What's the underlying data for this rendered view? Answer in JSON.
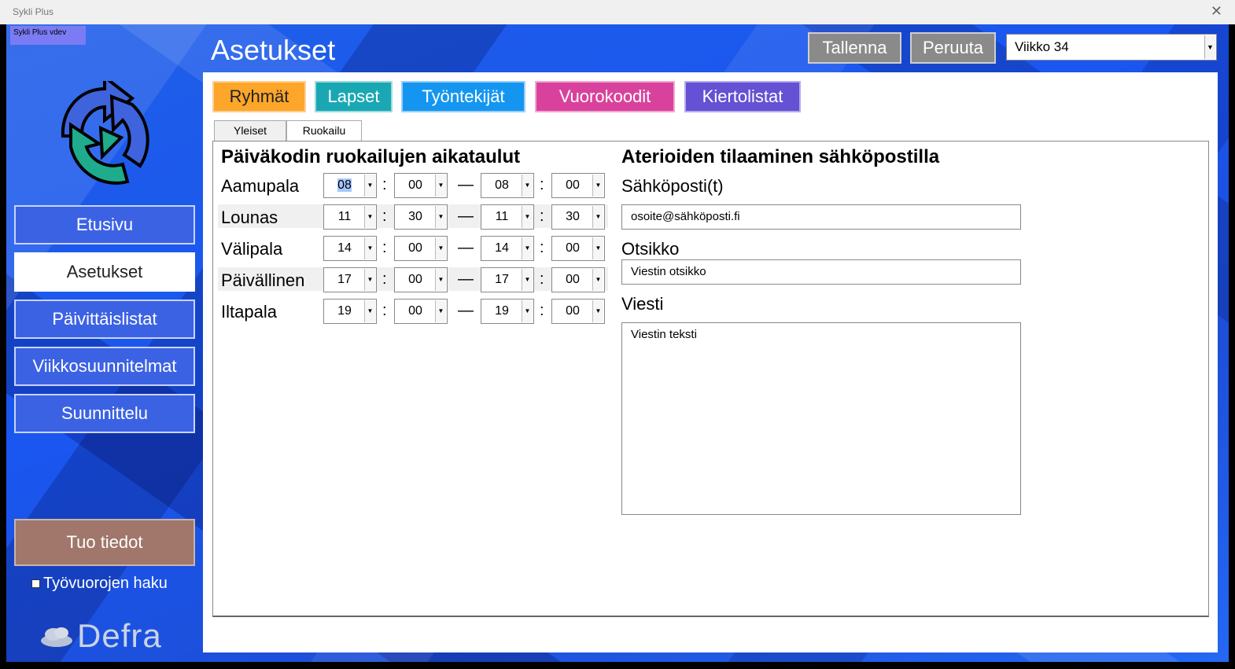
{
  "window": {
    "title": "Sykli Plus",
    "close_glyph": "✕"
  },
  "version_label": "Sykli Plus vdev",
  "sidebar": {
    "items": [
      {
        "label": "Etusivu"
      },
      {
        "label": "Asetukset"
      },
      {
        "label": "Päivittäislistat"
      },
      {
        "label": "Viikkosuunnitelmat"
      },
      {
        "label": "Suunnittelu"
      }
    ],
    "import_label": "Tuo tiedot",
    "checkbox_label": "Työvuorojen haku",
    "brand": "Defra"
  },
  "header": {
    "title": "Asetukset",
    "save_label": "Tallenna",
    "cancel_label": "Peruuta",
    "week_selected": "Viikko 34"
  },
  "categories": [
    {
      "label": "Ryhmät",
      "color": "#fda62a"
    },
    {
      "label": "Lapset",
      "color": "#1aa7b4"
    },
    {
      "label": "Työntekijät",
      "color": "#1496f0"
    },
    {
      "label": "Vuorokoodit",
      "color": "#d9429c"
    },
    {
      "label": "Kiertolistat",
      "color": "#6451d4"
    }
  ],
  "tabs": [
    {
      "label": "Yleiset"
    },
    {
      "label": "Ruokailu"
    }
  ],
  "meals": {
    "title": "Päiväkodin ruokailujen aikataulut",
    "separator": ":",
    "range_dash": "—",
    "rows": [
      {
        "label": "Aamupala",
        "start_h": "08",
        "start_m": "00",
        "end_h": "08",
        "end_m": "00"
      },
      {
        "label": "Lounas",
        "start_h": "11",
        "start_m": "30",
        "end_h": "11",
        "end_m": "30"
      },
      {
        "label": "Välipala",
        "start_h": "14",
        "start_m": "00",
        "end_h": "14",
        "end_m": "00"
      },
      {
        "label": "Päivällinen",
        "start_h": "17",
        "start_m": "00",
        "end_h": "17",
        "end_m": "00"
      },
      {
        "label": "Iltapala",
        "start_h": "19",
        "start_m": "00",
        "end_h": "19",
        "end_m": "00"
      }
    ]
  },
  "email": {
    "title": "Aterioiden tilaaminen sähköpostilla",
    "address_label": "Sähköposti(t)",
    "address_value": "osoite@sähköposti.fi",
    "subject_label": "Otsikko",
    "subject_value": "Viestin otsikko",
    "message_label": "Viesti",
    "message_value": "Viestin teksti"
  }
}
